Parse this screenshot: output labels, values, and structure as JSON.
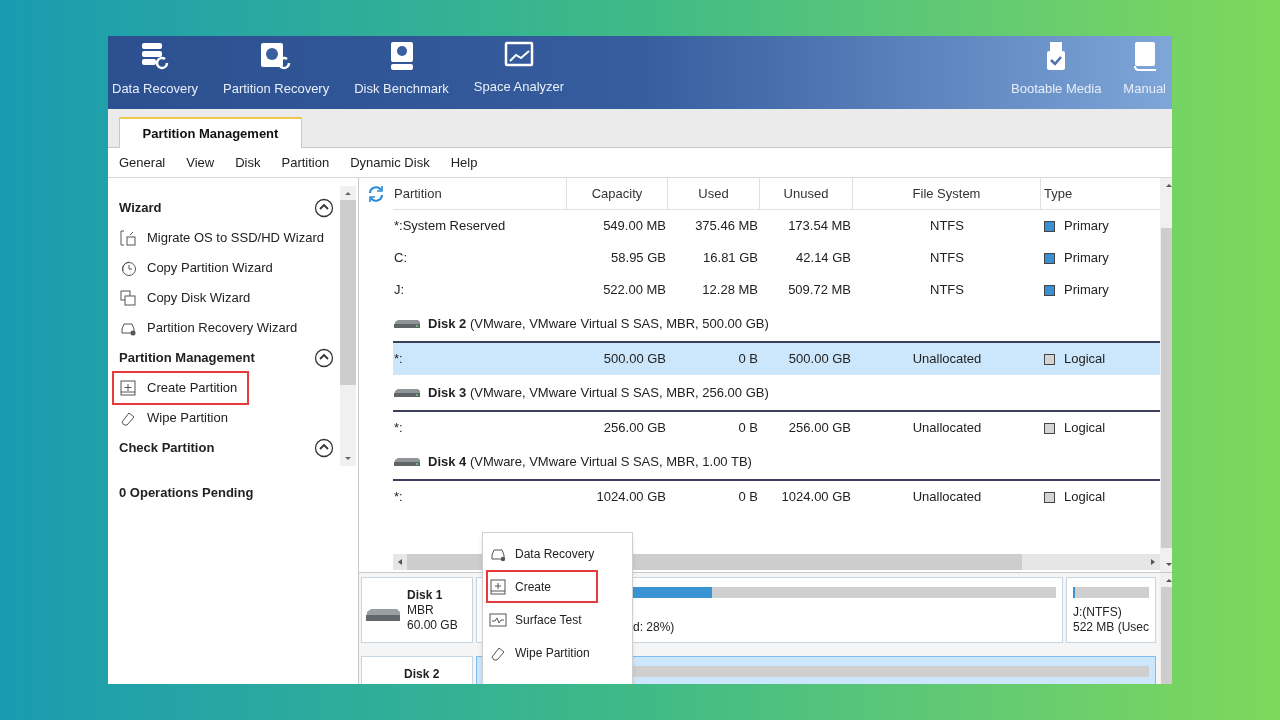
{
  "toolbar": {
    "left": [
      {
        "label": "Data Recovery"
      },
      {
        "label": "Partition Recovery"
      },
      {
        "label": "Disk Benchmark"
      },
      {
        "label": "Space Analyzer"
      }
    ],
    "right": [
      {
        "label": "Bootable Media"
      },
      {
        "label": "Manual"
      }
    ]
  },
  "tabs": [
    {
      "label": "Partition Management",
      "selected": true
    }
  ],
  "menu": [
    "General",
    "View",
    "Disk",
    "Partition",
    "Dynamic Disk",
    "Help"
  ],
  "sidebar": {
    "sections": [
      {
        "title": "Wizard",
        "expanded": true,
        "items": [
          {
            "label": "Migrate OS to SSD/HD Wizard",
            "highlighted": false
          },
          {
            "label": "Copy Partition Wizard",
            "highlighted": false
          },
          {
            "label": "Copy Disk Wizard",
            "highlighted": false
          },
          {
            "label": "Partition Recovery Wizard",
            "highlighted": false
          }
        ]
      },
      {
        "title": "Partition Management",
        "expanded": true,
        "items": [
          {
            "label": "Create Partition",
            "highlighted": true
          },
          {
            "label": "Wipe Partition",
            "highlighted": false
          }
        ]
      },
      {
        "title": "Check Partition",
        "expanded": true
      }
    ],
    "pending": "0 Operations Pending"
  },
  "table": {
    "columns": [
      "Partition",
      "Capacity",
      "Used",
      "Unused",
      "File System",
      "Type"
    ],
    "rows": [
      {
        "kind": "partition",
        "selected": false,
        "cells": [
          "*:System Reserved",
          "549.00 MB",
          "375.46 MB",
          "173.54 MB",
          "NTFS",
          "Primary"
        ],
        "color": "#3a8fd0"
      },
      {
        "kind": "partition",
        "selected": false,
        "cells": [
          "C:",
          "58.95 GB",
          "16.81 GB",
          "42.14 GB",
          "NTFS",
          "Primary"
        ],
        "color": "#3a8fd0"
      },
      {
        "kind": "partition",
        "selected": false,
        "cells": [
          "J:",
          "522.00 MB",
          "12.28 MB",
          "509.72 MB",
          "NTFS",
          "Primary"
        ],
        "color": "#3a8fd0"
      },
      {
        "kind": "disk",
        "name": "Disk 2",
        "details": "(VMware, VMware Virtual S SAS, MBR, 500.00 GB)"
      },
      {
        "kind": "partition",
        "selected": true,
        "cells": [
          "*:",
          "500.00 GB",
          "0 B",
          "500.00 GB",
          "Unallocated",
          "Logical"
        ],
        "color": "#d4d4d4"
      },
      {
        "kind": "disk",
        "name": "Disk 3",
        "details": "(VMware, VMware Virtual S SAS, MBR, 256.00 GB)"
      },
      {
        "kind": "partition",
        "selected": false,
        "cells": [
          "*:",
          "256.00 GB",
          "0 B",
          "256.00 GB",
          "Unallocated",
          "Logical"
        ],
        "color": "#d4d4d4"
      },
      {
        "kind": "disk",
        "name": "Disk 4",
        "details": "(VMware, VMware Virtual S SAS, MBR, 1.00 TB)"
      },
      {
        "kind": "partition",
        "selected": false,
        "cells": [
          "*:",
          "1024.00 GB",
          "0 B",
          "1024.00 GB",
          "Unallocated",
          "Logical"
        ],
        "color": "#d4d4d4"
      }
    ]
  },
  "disk_map": [
    {
      "name": "Disk 1",
      "lines": [
        "MBR",
        "60.00 GB"
      ],
      "partitions": [
        {
          "lines": [
            "d: 28%)"
          ],
          "level": 0.4,
          "selected": false
        },
        {
          "lines": [
            "J:(NTFS)",
            "522 MB (Usec"
          ],
          "level": 0.03,
          "selected": false
        }
      ]
    },
    {
      "name": "Disk 2",
      "partitions": [
        {
          "selected": true
        }
      ]
    }
  ],
  "context_menu": [
    {
      "label": "Data Recovery",
      "highlighted": false
    },
    {
      "label": "Create",
      "highlighted": true
    },
    {
      "label": "Surface Test",
      "highlighted": false
    },
    {
      "label": "Wipe Partition",
      "highlighted": false
    }
  ]
}
